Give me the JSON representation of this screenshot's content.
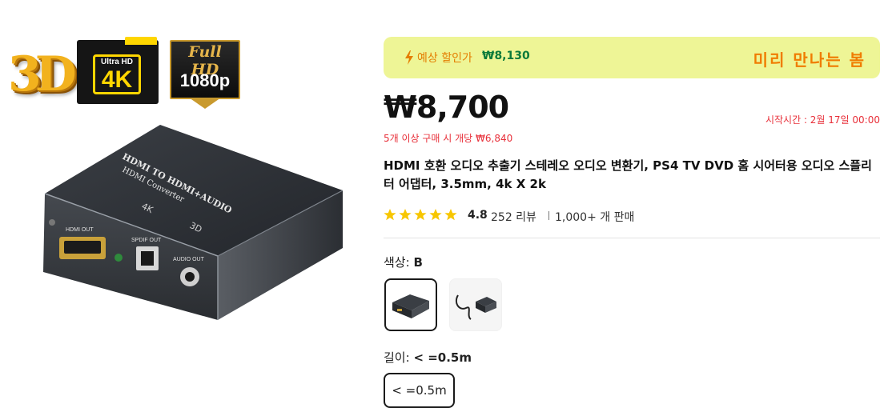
{
  "badges": {
    "three_d": "3D",
    "ultra_hd": "Ultra HD",
    "four_k": "4K",
    "full_hd": "Full HD",
    "resolution": "1080p"
  },
  "product_image": {
    "device_top_text_1": "HDMI TO HDMI+AUDIO",
    "device_top_text_2": "HDMI Converter",
    "device_model": "4K",
    "device_3d": "3D",
    "port_hdmi": "HDMI OUT",
    "port_spdif": "SPDIF OUT",
    "port_audio": "AUDIO OUT"
  },
  "promo": {
    "label": "예상 할인가",
    "value": "₩8,130",
    "campaign": "미리 만나는 봄",
    "background": "#eef596",
    "accent": "#f07c00"
  },
  "price": {
    "current": "₩8,700",
    "bulk_note": "5개 이상 구매 시 개당 ₩6,840",
    "start_time": "시작시간 : 2월 17일 00:00"
  },
  "product": {
    "title": "HDMI 호환 오디오 추출기 스테레오 오디오 변환기, PS4 TV DVD 홈 시어터용 오디오 스플리터 어댑터, 3.5mm, 4k X 2k"
  },
  "rating": {
    "stars": 5,
    "score": "4.8",
    "reviews": "252 리뷰",
    "sold": "1,000+ 개 판매"
  },
  "options": {
    "color_label": "색상:",
    "color_value": "B",
    "length_label": "길이:",
    "length_value": "< =0.5m",
    "length_choice": "< =0.5m"
  },
  "colors": {
    "alert_red": "#e8303a",
    "star_yellow": "#f7c600",
    "discount_green": "#0a7a3a"
  }
}
